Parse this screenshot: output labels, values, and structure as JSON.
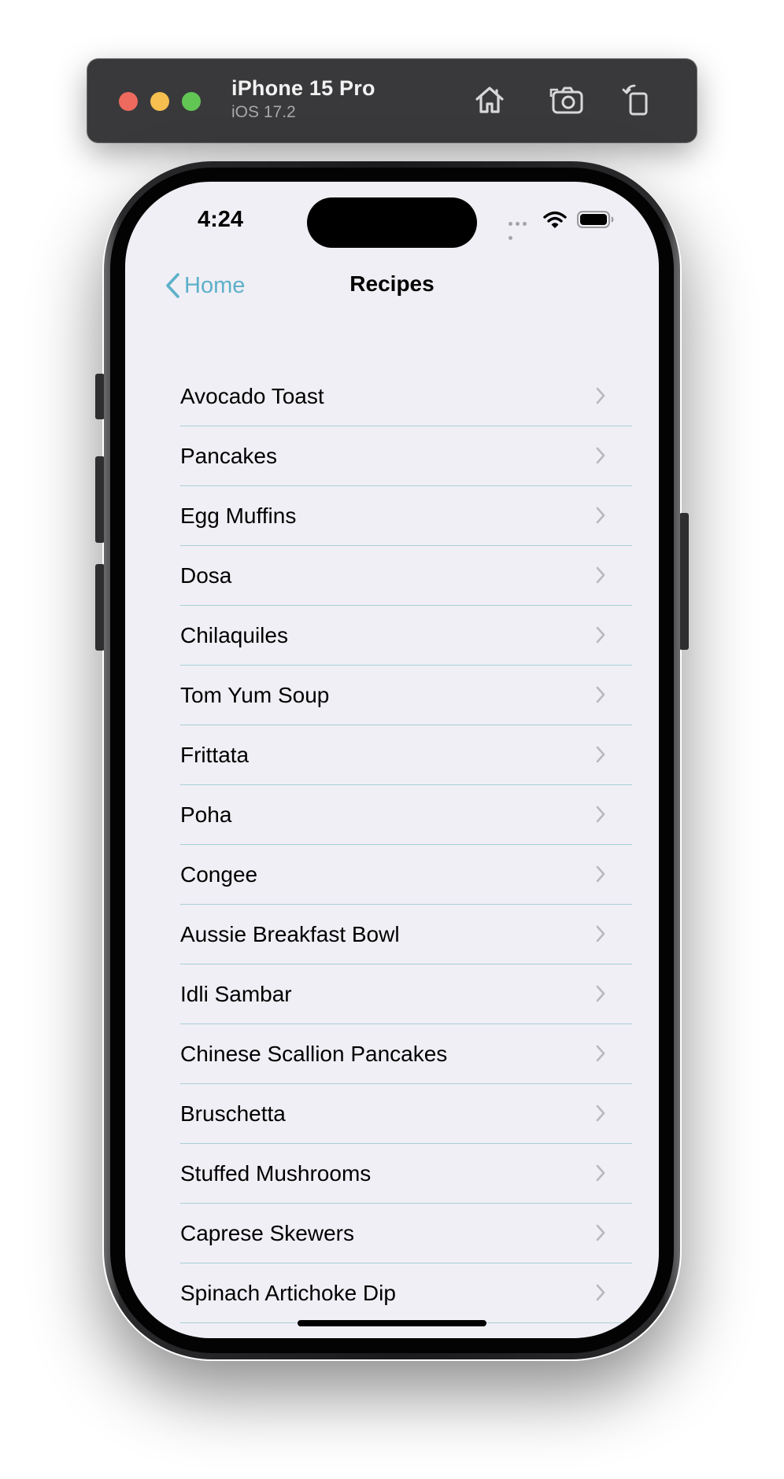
{
  "simulator": {
    "device_name": "iPhone 15 Pro",
    "os_version": "iOS 17.2",
    "toolbar_icons": [
      "home-icon",
      "screenshot-icon",
      "rotate-icon"
    ]
  },
  "status_bar": {
    "time": "4:24",
    "icons": [
      "cellular-dots-icon",
      "wifi-icon",
      "battery-icon"
    ]
  },
  "nav": {
    "back_label": "Home",
    "title": "Recipes"
  },
  "recipes": [
    "Avocado Toast",
    "Pancakes",
    "Egg Muffins",
    "Dosa",
    "Chilaquiles",
    "Tom Yum Soup",
    "Frittata",
    "Poha",
    "Congee",
    "Aussie Breakfast Bowl",
    "Idli Sambar",
    "Chinese Scallion Pancakes",
    "Bruschetta",
    "Stuffed Mushrooms",
    "Caprese Skewers",
    "Spinach Artichoke Dip"
  ],
  "colors": {
    "accent": "#5db0c9",
    "list_background": "#f0eff5",
    "separator": "#a7cfd8",
    "chevron": "#b9b9bd"
  }
}
